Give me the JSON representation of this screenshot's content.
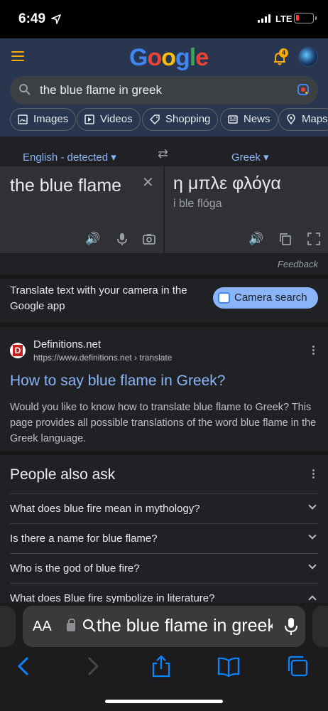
{
  "status": {
    "time": "6:49",
    "location_icon": "location-arrow-icon",
    "network": "LTE",
    "battery_level": 0.1
  },
  "header": {
    "logo": "Google",
    "notification_count": "4",
    "query": "the blue flame in greek"
  },
  "chips": [
    "Images",
    "Videos",
    "Shopping",
    "News",
    "Maps"
  ],
  "translate": {
    "source_lang": "English - detected",
    "target_lang": "Greek",
    "source_text": "the blue flame",
    "target_text": "η μπλε φλόγα",
    "transliteration": "i ble flóga",
    "feedback": "Feedback"
  },
  "camera_promo": {
    "text": "Translate text with your camera in the Google app",
    "button": "Camera search"
  },
  "result": {
    "favicon_letter": "D",
    "site_name": "Definitions.net",
    "url": "https://www.definitions.net › translate",
    "title": "How to say blue flame in Greek?",
    "snippet": "Would you like to know how to translate blue flame to Greek? This page provides all possible translations of the word blue flame in the Greek language."
  },
  "people_also_ask": {
    "title": "People also ask",
    "questions": [
      "What does blue fire mean in mythology?",
      "Is there a name for blue flame?",
      "Who is the god of blue fire?",
      "What does Blue fire symbolize in literature?"
    ]
  },
  "safari": {
    "aa_label": "AA",
    "url_text": "the blue flame in greek"
  },
  "colors": {
    "header_bg": "#29364f",
    "link": "#8ab4f8",
    "page_bg": "#202124"
  }
}
